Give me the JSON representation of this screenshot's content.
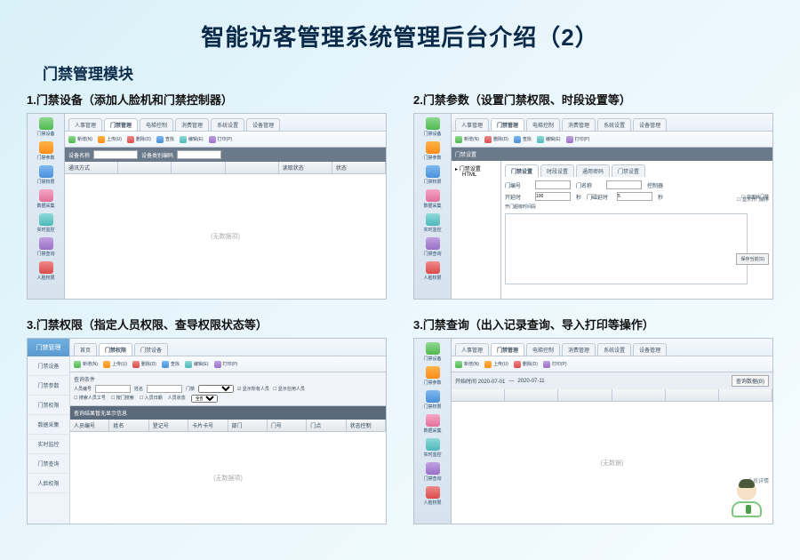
{
  "page_title": "智能访客管理系统管理后台介绍（2）",
  "section_title": "门禁管理模块",
  "panels": [
    {
      "caption": "1.门禁设备（添加人脸机和门禁控制器）"
    },
    {
      "caption": "2.门禁参数（设置门禁权限、时段设置等）"
    },
    {
      "caption": "3.门禁权限（指定人员权限、查导权限状态等）"
    },
    {
      "caption": "3.门禁查询（出入记录查询、导入打印等操作）"
    }
  ],
  "top_menu": {
    "items": [
      "人事管理",
      "门禁管理",
      "电梯控制",
      "消费管理",
      "系统设置",
      "设备管理"
    ]
  },
  "toolbar": {
    "new": "新增(N)",
    "upload": "上传(U)",
    "delete": "删除(D)",
    "edit": "编辑(E)",
    "print": "打印(P)",
    "search": "查找"
  },
  "sidebar": {
    "items": [
      {
        "label": "门禁设备",
        "color": "c-orange"
      },
      {
        "label": "门禁参数",
        "color": "c-green"
      },
      {
        "label": "门禁权限",
        "color": "c-blue"
      },
      {
        "label": "数据采集",
        "color": "c-pink"
      },
      {
        "label": "实时监控",
        "color": "c-cyan"
      },
      {
        "label": "门禁查询",
        "color": "c-purple"
      },
      {
        "label": "人脸权限",
        "color": "c-red"
      }
    ]
  },
  "subnav_head": "门禁管理",
  "subnav_items": [
    "门禁设备",
    "门禁参数",
    "门禁权限",
    "数据采集",
    "实时监控",
    "门禁查询",
    "人脸权限"
  ],
  "panel1": {
    "filter_label": "设备名称",
    "filter2_label": "设备类别编码",
    "columns": [
      "通讯方式",
      "",
      "",
      "",
      "",
      "读取状态",
      "状态"
    ]
  },
  "panel2": {
    "tree_root": "门禁设置",
    "tree_child": "HTML",
    "form_tabs": [
      "门禁设置",
      "时段设置",
      "通用密码",
      "门禁设置"
    ],
    "fields": {
      "door_no": "门编号",
      "door_name": "门名称",
      "open_delay": "开延时",
      "close_delay": "门磁延时",
      "open_val": "100",
      "close_val": "5",
      "unit": "秒",
      "controller": "控制器",
      "section_label": "开门超级时间段",
      "checkbox1": "启用此门禁",
      "checkbox2": "显示开门顺序"
    },
    "save_btn": "保存当前(S)"
  },
  "panel3": {
    "tabs": [
      "首页",
      "门禁权限",
      "门禁设备"
    ],
    "filter": {
      "group_header": "查询条件",
      "emp_no": "人员编号",
      "name": "姓名",
      "door": "门禁",
      "all": "显示所有人员",
      "active": "显示在用人员",
      "opt1": "搜索人员工号",
      "opt2": "按门搜索",
      "opt3": "入员日期",
      "opt4": "人员状态",
      "opt4b": "全部"
    },
    "result_header": "查询结果暂无显示信息",
    "columns": [
      "人员编号",
      "姓名",
      "登记号",
      "卡片卡号",
      "部门",
      "门号",
      "门点",
      "状态控制"
    ],
    "placeholder": "(无数据项)"
  },
  "panel4": {
    "filter": {
      "start": "开始时间 2020-07-01",
      "end": "2020-07-11",
      "btn": "查询数据(B)"
    },
    "placeholder": "(无数据)",
    "right_label": "人员详情"
  }
}
